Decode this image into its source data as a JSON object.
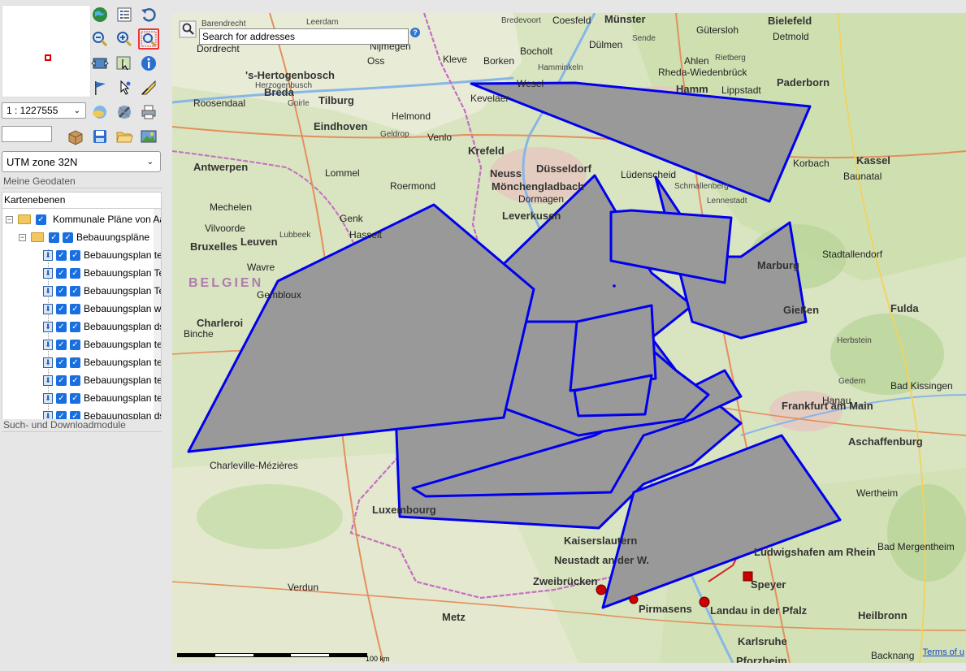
{
  "toolbar": {
    "scale_value": "1 : 1227555",
    "coord_value": "",
    "crs_value": "UTM zone 32N"
  },
  "panels": {
    "geodata_title": "Meine Geodaten",
    "layers_title": "Kartenebenen",
    "search_download_title": "Such- und Downloadmodule"
  },
  "layers": {
    "root_label": "Kommunale Pläne von Aa",
    "group_label": "Bebauungspläne",
    "items": [
      "Bebauungsplan te",
      "Bebauungsplan Te",
      "Bebauungsplan Te",
      "Bebauungsplan we",
      "Bebauungsplan ds",
      "Bebauungsplan te",
      "Bebauungsplan te",
      "Bebauungsplan te",
      "Bebauungsplan te",
      "Bebauungsplan ds"
    ]
  },
  "map": {
    "search_placeholder": "Search for addresses",
    "help_symbol": "?",
    "scale_label": "100 km",
    "terms_label": "Terms of u",
    "polygon_fill": "#999999",
    "polygon_stroke": "#0000ee",
    "places": [
      {
        "name": "Barendrecht",
        "size": "small"
      },
      {
        "name": "Leerdam",
        "size": "small"
      },
      {
        "name": "Nijmegen",
        "size": "med"
      },
      {
        "name": "Bredevoort",
        "size": "small"
      },
      {
        "name": "Coesfeld",
        "size": "med"
      },
      {
        "name": "Münster",
        "size": "big"
      },
      {
        "name": "Bielefeld",
        "size": "big"
      },
      {
        "name": "Dordrecht",
        "size": "med"
      },
      {
        "name": "Gütersloh",
        "size": "med"
      },
      {
        "name": "Detmold",
        "size": "med"
      },
      {
        "name": "Oss",
        "size": "med"
      },
      {
        "name": "Kleve",
        "size": "med"
      },
      {
        "name": "Borken",
        "size": "med"
      },
      {
        "name": "Dülmen",
        "size": "med"
      },
      {
        "name": "Sende",
        "size": "small"
      },
      {
        "name": "'s-Hertogenbosch",
        "size": "big"
      },
      {
        "name": "Herzogenbusch",
        "size": "small"
      },
      {
        "name": "Bocholt",
        "size": "med"
      },
      {
        "name": "Wesel",
        "size": "med"
      },
      {
        "name": "Hamminkeln",
        "size": "small"
      },
      {
        "name": "Rheda-Wiedenbrück",
        "size": "med"
      },
      {
        "name": "Rietberg",
        "size": "small"
      },
      {
        "name": "Paderborn",
        "size": "big"
      },
      {
        "name": "Ahlen",
        "size": "med"
      },
      {
        "name": "Hamm",
        "size": "big"
      },
      {
        "name": "Lippstadt",
        "size": "med"
      },
      {
        "name": "Breda",
        "size": "big"
      },
      {
        "name": "Tilburg",
        "size": "big"
      },
      {
        "name": "Roosendaal",
        "size": "med"
      },
      {
        "name": "Goirle",
        "size": "small"
      },
      {
        "name": "Helmond",
        "size": "med"
      },
      {
        "name": "Eindhoven",
        "size": "big"
      },
      {
        "name": "Geldrop",
        "size": "small"
      },
      {
        "name": "Venlo",
        "size": "med"
      },
      {
        "name": "Kevelaer",
        "size": "med"
      },
      {
        "name": "Krefeld",
        "size": "big"
      },
      {
        "name": "Neuss",
        "size": "big"
      },
      {
        "name": "Düsseldorf",
        "size": "big"
      },
      {
        "name": "Mönchengladbach",
        "size": "big"
      },
      {
        "name": "Dormagen",
        "size": "med"
      },
      {
        "name": "Leverkusen",
        "size": "big"
      },
      {
        "name": "Lüdenscheid",
        "size": "med"
      },
      {
        "name": "Schmallenberg",
        "size": "small"
      },
      {
        "name": "Lennestadt",
        "size": "small"
      },
      {
        "name": "Korbach",
        "size": "med"
      },
      {
        "name": "Kassel",
        "size": "big"
      },
      {
        "name": "Baunatal",
        "size": "med"
      },
      {
        "name": "Antwerpen",
        "size": "big"
      },
      {
        "name": "Lommel",
        "size": "med"
      },
      {
        "name": "Roermond",
        "size": "med"
      },
      {
        "name": "Mechelen",
        "size": "med"
      },
      {
        "name": "Genk",
        "size": "med"
      },
      {
        "name": "Hasselt",
        "size": "med"
      },
      {
        "name": "Leuven",
        "size": "big"
      },
      {
        "name": "Bruxelles",
        "size": "big"
      },
      {
        "name": "Lubbeek",
        "size": "small"
      },
      {
        "name": "Vilvoorde",
        "size": "med"
      },
      {
        "name": "BELGIEN",
        "size": "country"
      },
      {
        "name": "Wavre",
        "size": "med"
      },
      {
        "name": "Gembloux",
        "size": "med"
      },
      {
        "name": "Binche",
        "size": "med"
      },
      {
        "name": "Charleroi",
        "size": "big"
      },
      {
        "name": "Marburg",
        "size": "big"
      },
      {
        "name": "Stadtallendorf",
        "size": "med"
      },
      {
        "name": "Gießen",
        "size": "big"
      },
      {
        "name": "Fulda",
        "size": "big"
      },
      {
        "name": "Herbstein",
        "size": "small"
      },
      {
        "name": "Frankfurt am Main",
        "size": "big"
      },
      {
        "name": "Hanau",
        "size": "med"
      },
      {
        "name": "Gedern",
        "size": "small"
      },
      {
        "name": "Aschaffenburg",
        "size": "big"
      },
      {
        "name": "Bad Kissingen",
        "size": "med"
      },
      {
        "name": "Charleville-Mézières",
        "size": "med"
      },
      {
        "name": "Luxembourg",
        "size": "big"
      },
      {
        "name": "Kaiserslautern",
        "size": "big"
      },
      {
        "name": "Neustadt an der W.",
        "size": "big"
      },
      {
        "name": "Ludwigshafen am Rhein",
        "size": "big"
      },
      {
        "name": "Speyer",
        "size": "big"
      },
      {
        "name": "Zweibrücken",
        "size": "big"
      },
      {
        "name": "Pirmasens",
        "size": "big"
      },
      {
        "name": "Landau in der Pfalz",
        "size": "big"
      },
      {
        "name": "Heilbronn",
        "size": "big"
      },
      {
        "name": "Karlsruhe",
        "size": "big"
      },
      {
        "name": "Metz",
        "size": "big"
      },
      {
        "name": "Verdun",
        "size": "med"
      },
      {
        "name": "Pforzheim",
        "size": "big"
      },
      {
        "name": "Backnang",
        "size": "med"
      },
      {
        "name": "Bad Mergentheim",
        "size": "med"
      },
      {
        "name": "Wertheim",
        "size": "med"
      }
    ]
  },
  "colors": {
    "accent": "#1a6fe0",
    "polygon_stroke": "#0000ee",
    "polygon_fill": "#999999",
    "selected_tool_border": "#ee3333"
  }
}
